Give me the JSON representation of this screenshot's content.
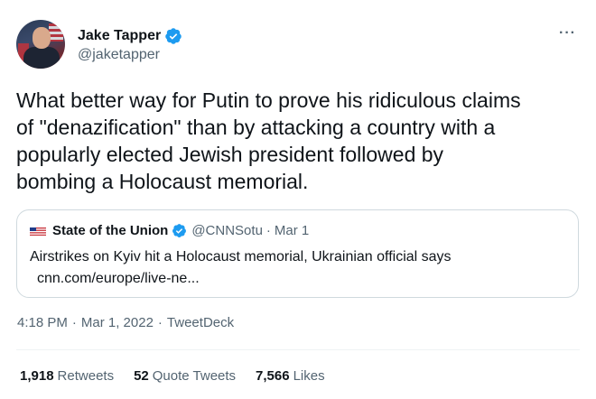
{
  "author": {
    "name": "Jake Tapper",
    "handle": "@jaketapper",
    "verified": true
  },
  "menu": {
    "more_label": "···"
  },
  "tweet": {
    "lines": [
      "What better way for Putin to prove his ridiculous claims",
      "of \"denazification\" than by attacking a country with a",
      "popularly elected Jewish president followed by",
      "bombing a Holocaust memorial."
    ]
  },
  "quote": {
    "name": "State of the Union",
    "handle": "@CNNSotu",
    "separator": "·",
    "date": "Mar 1",
    "text": "Airstrikes on Kyiv hit a Holocaust memorial, Ukrainian official says",
    "link": "cnn.com/europe/live-ne..."
  },
  "meta": {
    "time": "4:18 PM",
    "separator": "·",
    "date": "Mar 1, 2022",
    "source": "TweetDeck"
  },
  "stats": {
    "retweets": {
      "count": "1,918",
      "label": "Retweets"
    },
    "quotes": {
      "count": "52",
      "label": "Quote Tweets"
    },
    "likes": {
      "count": "7,566",
      "label": "Likes"
    }
  },
  "colors": {
    "verified_blue": "#1d9bf0",
    "text_primary": "#0f1419",
    "text_secondary": "#536471",
    "border": "#cfd9de"
  }
}
